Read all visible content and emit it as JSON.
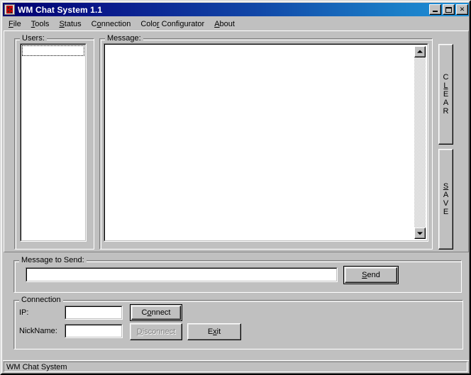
{
  "window": {
    "title": "WM Chat System 1.1",
    "icon": "app-icon",
    "controls": {
      "minimize": "minimize-icon",
      "maximize": "maximize-icon",
      "close": "✕"
    }
  },
  "menubar": {
    "items": [
      {
        "label": "File",
        "pre": "",
        "mnemonic": "F",
        "post": "ile"
      },
      {
        "label": "Tools",
        "pre": "",
        "mnemonic": "T",
        "post": "ools"
      },
      {
        "label": "Status",
        "pre": "",
        "mnemonic": "S",
        "post": "tatus"
      },
      {
        "label": "Connection",
        "pre": "C",
        "mnemonic": "o",
        "post": "nnection"
      },
      {
        "label": "Color Configurator",
        "pre": "Colo",
        "mnemonic": "r",
        "post": " Configurator"
      },
      {
        "label": "About",
        "pre": "",
        "mnemonic": "A",
        "post": "bout"
      }
    ]
  },
  "users": {
    "group_title": "Users:",
    "items": [],
    "focused_index": 0
  },
  "message": {
    "group_title": "Message:",
    "content": "",
    "scrollbar": {
      "up_arrow": "scroll-up-icon",
      "down_arrow": "scroll-down-icon"
    }
  },
  "side_buttons": {
    "clear": {
      "letters": [
        "C",
        "L",
        "E",
        "A",
        "R"
      ],
      "mnemonic_index": 1
    },
    "save": {
      "letters": [
        "S",
        "A",
        "V",
        "E"
      ],
      "mnemonic_index": 0
    }
  },
  "message_to_send": {
    "group_title": "Message to Send:",
    "input_value": "",
    "input_placeholder": "",
    "send_button": {
      "pre": "",
      "mnemonic": "S",
      "post": "end"
    }
  },
  "connection": {
    "group_title": "Connection",
    "ip_label": "IP:",
    "ip_value": "",
    "nickname_label": "NickName:",
    "nickname_value": "",
    "connect_button": {
      "pre": "C",
      "mnemonic": "o",
      "post": "nnect",
      "enabled": true,
      "default": true
    },
    "disconnect_button": {
      "pre": "",
      "mnemonic": "D",
      "post": "isconnect",
      "enabled": false,
      "default": false
    },
    "exit_button": {
      "pre": "E",
      "mnemonic": "x",
      "post": "it",
      "enabled": true,
      "default": false
    }
  },
  "statusbar": {
    "text": "WM Chat System"
  },
  "colors": {
    "face": "#c0c0c0",
    "title_gradient_start": "#00006e",
    "title_gradient_end": "#2090d8",
    "field_bg": "#ffffff",
    "disabled_text": "#808080",
    "icon_red": "#c00000"
  }
}
